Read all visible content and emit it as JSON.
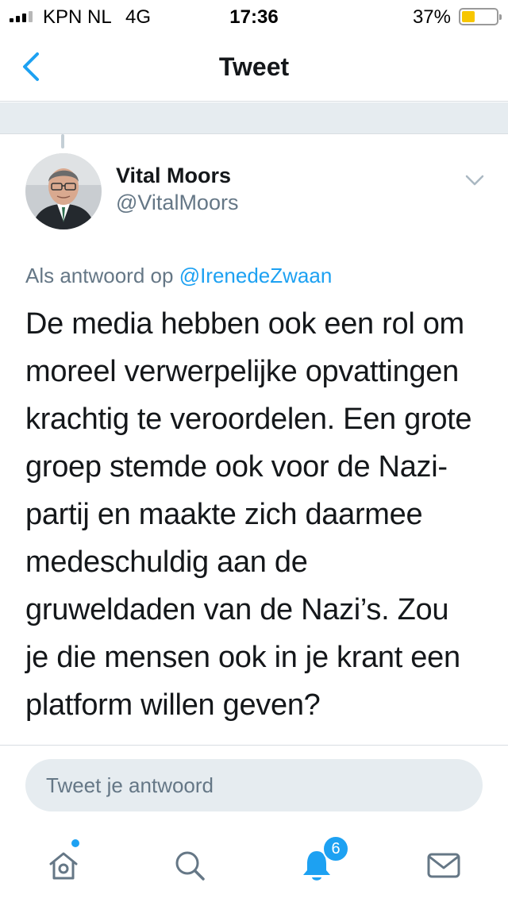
{
  "status_bar": {
    "carrier": "KPN NL",
    "network": "4G",
    "time": "17:36",
    "battery_percent_text": "37%",
    "battery_level": 0.37,
    "signal_bars_active": 3,
    "signal_bars_total": 4
  },
  "nav": {
    "title": "Tweet",
    "back_icon": "chevron-left-icon"
  },
  "tweet": {
    "author_name": "Vital Moors",
    "author_handle": "@VitalMoors",
    "reply_prefix": "Als antwoord op",
    "reply_mention": "@IrenedeZwaan",
    "body_lines": [
      "De media hebben ook een rol om",
      "moreel verwerpelijke opvattingen",
      "krachtig te veroordelen. Een grote",
      "groep stemde ook voor de Nazi-",
      "partij en maakte zich daarmee",
      "medeschuldig aan de",
      "gruweldaden van de Nazi’s. Zou",
      "je die mensen ook in je krant een",
      "platform willen geven?"
    ]
  },
  "reply_box": {
    "placeholder": "Tweet je antwoord"
  },
  "tabbar": {
    "notifications_badge": "6",
    "items": [
      "home-icon",
      "search-icon",
      "bell-icon",
      "mail-icon"
    ]
  },
  "colors": {
    "accent": "#1da1f2",
    "secondary_text": "#657786",
    "band": "#e6ecf0",
    "battery_fill": "#f7c600"
  }
}
